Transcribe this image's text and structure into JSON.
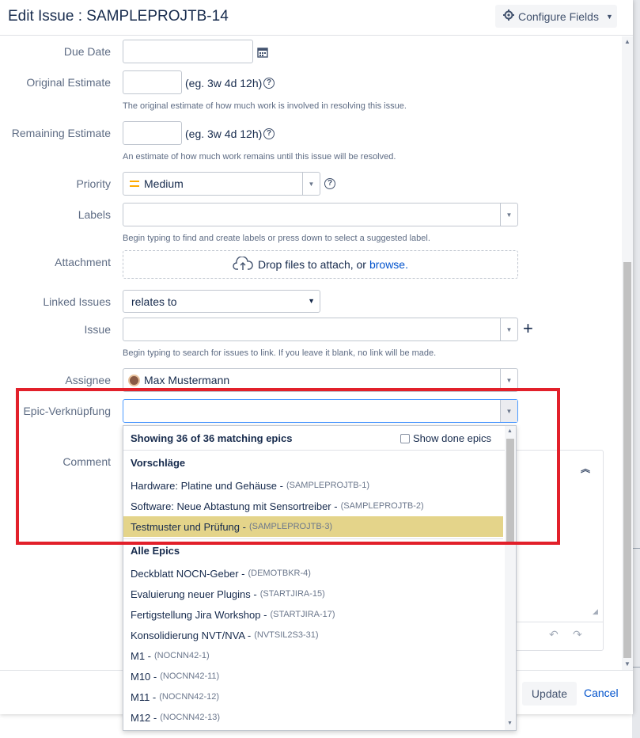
{
  "dialog": {
    "title": "Edit Issue : SAMPLEPROJTB-14",
    "configure_fields_label": "Configure Fields"
  },
  "form": {
    "due_date": {
      "label": "Due Date",
      "value": ""
    },
    "original_estimate": {
      "label": "Original Estimate",
      "value": "",
      "example": "(eg. 3w 4d 12h)",
      "description": "The original estimate of how much work is involved in resolving this issue."
    },
    "remaining_estimate": {
      "label": "Remaining Estimate",
      "value": "",
      "example": "(eg. 3w 4d 12h)",
      "description": "An estimate of how much work remains until this issue will be resolved."
    },
    "priority": {
      "label": "Priority",
      "value": "Medium",
      "color": "#ffab00"
    },
    "labels": {
      "label": "Labels",
      "value": "",
      "hint": "Begin typing to find and create labels or press down to select a suggested label."
    },
    "attachment": {
      "label": "Attachment",
      "drop_text": "Drop files to attach, or",
      "browse_link": "browse."
    },
    "linked_issues": {
      "label": "Linked Issues",
      "value": "relates to"
    },
    "issue": {
      "label": "Issue",
      "value": "",
      "hint": "Begin typing to search for issues to link. If you leave it blank, no link will be made."
    },
    "assignee": {
      "label": "Assignee",
      "value": "Max Mustermann"
    },
    "epic_link": {
      "label": "Epic-Verknüpfung",
      "value": ""
    },
    "comment": {
      "label": "Comment"
    }
  },
  "epic_dropdown": {
    "showing": "Showing 36 of 36 matching epics",
    "show_done_label": "Show done epics",
    "show_done_checked": false,
    "suggestions_heading": "Vorschläge",
    "suggestions": [
      {
        "name": "Hardware: Platine und Gehäuse -",
        "key": "(SAMPLEPROJTB-1)"
      },
      {
        "name": "Software: Neue Abtastung mit Sensortreiber -",
        "key": "(SAMPLEPROJTB-2)"
      },
      {
        "name": "Testmuster und Prüfung -",
        "key": "(SAMPLEPROJTB-3)",
        "selected": true
      }
    ],
    "all_heading": "Alle Epics",
    "all_epics": [
      {
        "name": "Deckblatt NOCN-Geber -",
        "key": "(DEMOTBKR-4)"
      },
      {
        "name": "Evaluierung neuer Plugins -",
        "key": "(STARTJIRA-15)"
      },
      {
        "name": "Fertigstellung Jira Workshop -",
        "key": "(STARTJIRA-17)"
      },
      {
        "name": "Konsolidierung NVT/NVA -",
        "key": "(NVTSIL2S3-31)"
      },
      {
        "name": "M1 -",
        "key": "(NOCNN42-1)"
      },
      {
        "name": "M10 -",
        "key": "(NOCNN42-11)"
      },
      {
        "name": "M11 -",
        "key": "(NOCNN42-12)"
      },
      {
        "name": "M12 -",
        "key": "(NOCNN42-13)"
      }
    ]
  },
  "footer": {
    "update_label": "Update",
    "cancel_label": "Cancel"
  },
  "colors": {
    "highlight": "#e2202a",
    "selected_row": "#e4d48a",
    "link": "#0052cc"
  }
}
